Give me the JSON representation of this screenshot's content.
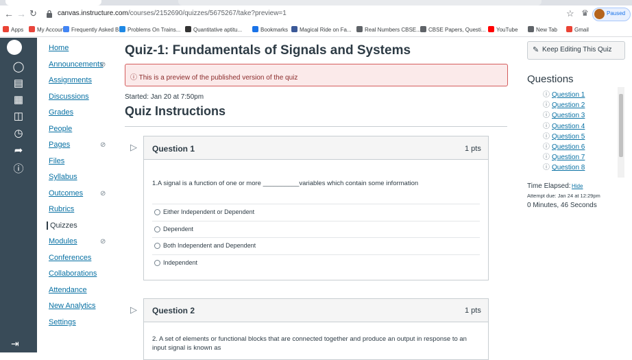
{
  "browser": {
    "url_host": "canvas.instructure.com",
    "url_path": "/courses/2152690/quizzes/5675267/take?preview=1",
    "profile_status": "Paused",
    "bookmarks": [
      {
        "label": "Apps",
        "color": "#ea4335"
      },
      {
        "label": "My Account",
        "color": "#e8453c"
      },
      {
        "label": "Frequently Asked B...",
        "color": "#4285f4"
      },
      {
        "label": "Problems On Trains...",
        "color": "#1e88e5"
      },
      {
        "label": "Quantitative aptitu...",
        "color": "#333333"
      },
      {
        "label": "Bookmarks",
        "color": "#1a73e8"
      },
      {
        "label": "Magical Ride on Fa...",
        "color": "#3b5998"
      },
      {
        "label": "Real Numbers CBSE...",
        "color": "#5f6368"
      },
      {
        "label": "CBSE Papers, Questi...",
        "color": "#5f6368"
      },
      {
        "label": "YouTube",
        "color": "#ff0000"
      },
      {
        "label": "New Tab",
        "color": "#5f6368"
      },
      {
        "label": "Gmail",
        "color": "#ea4335"
      }
    ]
  },
  "course_nav": {
    "items": [
      {
        "label": "Home",
        "hidden": false
      },
      {
        "label": "Announcements",
        "hidden": true
      },
      {
        "label": "Assignments",
        "hidden": false
      },
      {
        "label": "Discussions",
        "hidden": false
      },
      {
        "label": "Grades",
        "hidden": false
      },
      {
        "label": "People",
        "hidden": false
      },
      {
        "label": "Pages",
        "hidden": true
      },
      {
        "label": "Files",
        "hidden": false
      },
      {
        "label": "Syllabus",
        "hidden": false
      },
      {
        "label": "Outcomes",
        "hidden": true
      },
      {
        "label": "Rubrics",
        "hidden": false
      },
      {
        "label": "Quizzes",
        "hidden": false
      },
      {
        "label": "Modules",
        "hidden": true
      },
      {
        "label": "Conferences",
        "hidden": false
      },
      {
        "label": "Collaborations",
        "hidden": false
      },
      {
        "label": "Attendance",
        "hidden": false
      },
      {
        "label": "New Analytics",
        "hidden": false
      },
      {
        "label": "Settings",
        "hidden": false
      }
    ],
    "active": "Quizzes"
  },
  "quiz": {
    "title": "Quiz-1: Fundamentals of Signals and Systems",
    "preview_notice": "This is a preview of the published version of the quiz",
    "started": "Started: Jan 20 at 7:50pm",
    "instructions_heading": "Quiz Instructions",
    "questions": [
      {
        "title": "Question 1",
        "points": "1 pts",
        "text": "1.A signal is a function of one or more __________variables which contain some information",
        "answers": [
          "Either Independent or Dependent",
          "Dependent",
          "Both Independent and Dependent",
          "Independent"
        ]
      },
      {
        "title": "Question 2",
        "points": "1 pts",
        "text": "2. A set of elements or functional blocks that are connected together and produce an output in response to an input signal is known as"
      }
    ]
  },
  "sidebar": {
    "keep_editing_label": "Keep Editing This Quiz",
    "questions_heading": "Questions",
    "question_links": [
      "Question 1",
      "Question 2",
      "Question 3",
      "Question 4",
      "Question 5",
      "Question 6",
      "Question 7",
      "Question 8"
    ],
    "time_elapsed_label": "Time Elapsed:",
    "hide_label": "Hide",
    "attempt_due": "Attempt due: Jan 24 at 12:29pm",
    "elapsed_value": "0 Minutes, 46 Seconds"
  }
}
